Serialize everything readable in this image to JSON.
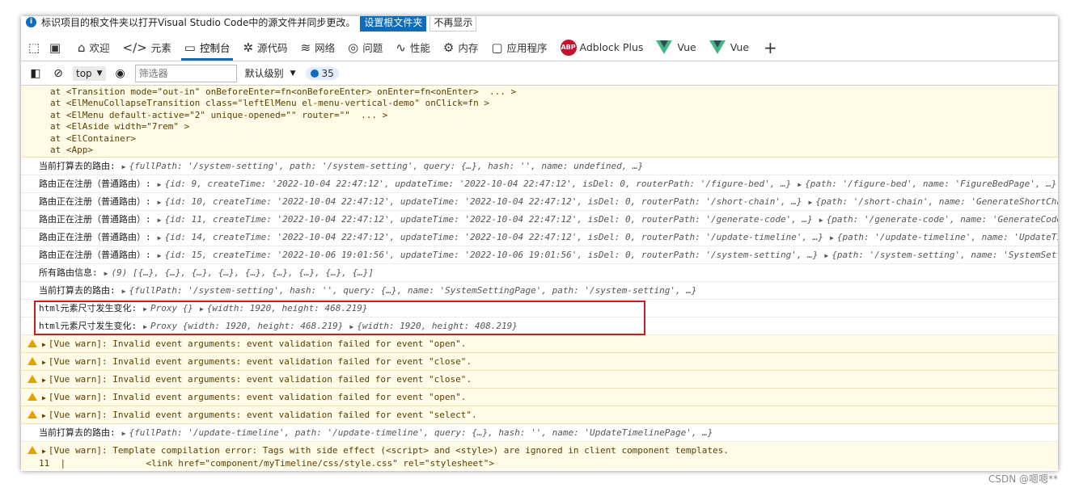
{
  "infobar": {
    "message": "标识项目的根文件夹以打开Visual Studio Code中的源文件并同步更改。",
    "primary_button": "设置根文件夹",
    "secondary_button": "不再显示"
  },
  "tabs": [
    {
      "label": "欢迎",
      "icon": "home-icon"
    },
    {
      "label": "元素",
      "icon": "code-icon"
    },
    {
      "label": "控制台",
      "icon": "console-icon",
      "active": true
    },
    {
      "label": "源代码",
      "icon": "bug-icon"
    },
    {
      "label": "网络",
      "icon": "wifi-icon"
    },
    {
      "label": "问题",
      "icon": "lightbulb-icon"
    },
    {
      "label": "性能",
      "icon": "performance-icon"
    },
    {
      "label": "内存",
      "icon": "memory-icon"
    },
    {
      "label": "应用程序",
      "icon": "app-icon"
    },
    {
      "label": "Adblock Plus",
      "icon": "abp-icon"
    },
    {
      "label": "Vue",
      "icon": "vue-icon"
    },
    {
      "label": "Vue",
      "icon": "vue-icon"
    }
  ],
  "filterbar": {
    "context": "top",
    "filter_placeholder": "筛选器",
    "level": "默认级别",
    "message_count": "35"
  },
  "stack_lines": [
    "at <Transition mode=\"out-in\" onBeforeEnter=fn<onBeforeEnter> onEnter=fn<onEnter>  ... >",
    "at <ElMenuCollapseTransition class=\"leftElMenu el-menu-vertical-demo\" onClick=fn >",
    "at <ElMenu default-active=\"2\" unique-opened=\"\" router=\"\"  ... >",
    "at <ElAside width=\"7rem\" >",
    "at <ElContainer>",
    "at <App>"
  ],
  "rows": [
    {
      "label": "当前打算去的路由:",
      "obj1": "{fullPath: '/system-setting', path: '/system-setting', query: {…}, hash: '', name: undefined, …}",
      "obj2": ""
    },
    {
      "label": "路由正在注册（普通路由）:",
      "obj1": "{id: 9, createTime: '2022-10-04 22:47:12', updateTime: '2022-10-04 22:47:12', isDel: 0, routerPath: '/figure-bed', …}",
      "obj2": "{path: '/figure-bed', name: 'FigureBedPage', …}"
    },
    {
      "label": "路由正在注册（普通路由）:",
      "obj1": "{id: 10, createTime: '2022-10-04 22:47:12', updateTime: '2022-10-04 22:47:12', isDel: 0, routerPath: '/short-chain', …}",
      "obj2": "{path: '/short-chain', name: 'GenerateShortChain', …}"
    },
    {
      "label": "路由正在注册（普通路由）:",
      "obj1": "{id: 11, createTime: '2022-10-04 22:47:12', updateTime: '2022-10-04 22:47:12', isDel: 0, routerPath: '/generate-code', …}",
      "obj2": "{path: '/generate-code', name: 'GenerateCode', …}"
    },
    {
      "label": "路由正在注册（普通路由）:",
      "obj1": "{id: 14, createTime: '2022-10-04 22:47:12', updateTime: '2022-10-04 22:47:12', isDel: 0, routerPath: '/update-timeline', …}",
      "obj2": "{path: '/update-timeline', name: 'UpdateTimeline', …}"
    },
    {
      "label": "路由正在注册（普通路由）:",
      "obj1": "{id: 15, createTime: '2022-10-06 19:01:56', updateTime: '2022-10-06 19:01:56', isDel: 0, routerPath: '/system-setting', …}",
      "obj2": "{path: '/system-setting', name: 'SystemSetting', …}"
    },
    {
      "label": "所有路由信息:",
      "obj1": "(9) [{…}, {…}, {…}, {…}, {…}, {…}, {…}, {…}, {…}]",
      "obj2": ""
    },
    {
      "label": "当前打算去的路由:",
      "obj1": "{fullPath: '/system-setting', hash: '', query: {…}, name: 'SystemSettingPage', path: '/system-setting', …}",
      "obj2": ""
    },
    {
      "label": "html元素尺寸发生变化:",
      "obj1": "Proxy {}",
      "obj2": "{width: 1920, height: 468.219}"
    },
    {
      "label": "html元素尺寸发生变化:",
      "obj1": "Proxy {width: 1920, height: 468.219}",
      "obj2": "{width: 1920, height: 408.219}"
    }
  ],
  "warnings": [
    "[Vue warn]: Invalid event arguments: event validation failed for event \"open\".",
    "[Vue warn]: Invalid event arguments: event validation failed for event \"close\".",
    "[Vue warn]: Invalid event arguments: event validation failed for event \"close\".",
    "[Vue warn]: Invalid event arguments: event validation failed for event \"open\".",
    "[Vue warn]: Invalid event arguments: event validation failed for event \"select\"."
  ],
  "route_row": {
    "label": "当前打算去的路由:",
    "obj1": "{fullPath: '/update-timeline', path: '/update-timeline', query: {…}, hash: '', name: 'UpdateTimelinePage', …}"
  },
  "template_warn": "[Vue warn]: Template compilation error: Tags with side effect (<script> and <style>) are ignored in client component templates.",
  "code_line": {
    "num": "11",
    "text": "<link href=\"component/myTimeline/css/style.css\" rel=\"stylesheet\">"
  },
  "watermark": "CSDN @嗯嗯**"
}
